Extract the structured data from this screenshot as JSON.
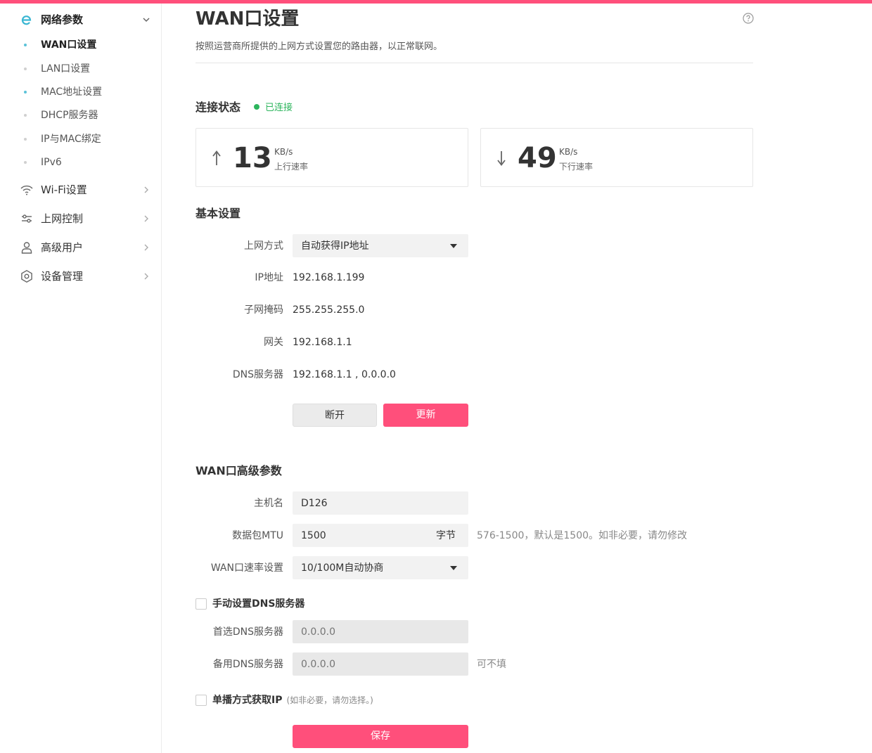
{
  "colors": {
    "accent": "#ff4f7b",
    "connected": "#2db55d",
    "active_dot": "#5bc2d8"
  },
  "sidebar": {
    "network": {
      "label": "网络参数",
      "icon": "brand-e-icon"
    },
    "sub_items": [
      {
        "label": "WAN口设置",
        "active": true
      },
      {
        "label": "LAN口设置",
        "active": false
      },
      {
        "label": "MAC地址设置",
        "active": true
      },
      {
        "label": "DHCP服务器",
        "active": false
      },
      {
        "label": "IP与MAC绑定",
        "active": false
      },
      {
        "label": "IPv6",
        "active": false
      }
    ],
    "groups": [
      {
        "label": "Wi-Fi设置",
        "icon": "wifi-icon"
      },
      {
        "label": "上网控制",
        "icon": "sliders-icon"
      },
      {
        "label": "高级用户",
        "icon": "user-icon"
      },
      {
        "label": "设备管理",
        "icon": "gear-icon"
      }
    ]
  },
  "page": {
    "title": "WAN口设置",
    "subtitle": "按照运营商所提供的上网方式设置您的路由器，以正常联网。"
  },
  "connection": {
    "title": "连接状态",
    "status": "已连接",
    "upload": {
      "value": "13",
      "unit": "KB/s",
      "label": "上行速率"
    },
    "download": {
      "value": "49",
      "unit": "KB/s",
      "label": "下行速率"
    }
  },
  "basic": {
    "title": "基本设置",
    "mode_label": "上网方式",
    "mode_value": "自动获得IP地址",
    "ip_label": "IP地址",
    "ip_value": "192.168.1.199",
    "mask_label": "子网掩码",
    "mask_value": "255.255.255.0",
    "gateway_label": "网关",
    "gateway_value": "192.168.1.1",
    "dns_label": "DNS服务器",
    "dns_value": "192.168.1.1 , 0.0.0.0",
    "disconnect_label": "断开",
    "renew_label": "更新"
  },
  "advanced": {
    "title": "WAN口高级参数",
    "hostname_label": "主机名",
    "hostname_value": "D126",
    "mtu_label": "数据包MTU",
    "mtu_value": "1500",
    "mtu_unit": "字节",
    "mtu_hint": "576-1500，默认是1500。如非必要，请勿修改",
    "speed_label": "WAN口速率设置",
    "speed_value": "10/100M自动协商",
    "manual_dns_label": "手动设置DNS服务器",
    "primary_dns_label": "首选DNS服务器",
    "primary_dns_placeholder": "0.0.0.0",
    "secondary_dns_label": "备用DNS服务器",
    "secondary_dns_placeholder": "0.0.0.0",
    "secondary_dns_hint": "可不填",
    "unicast_label": "单播方式获取IP",
    "unicast_note": "(如非必要，请勿选择。)",
    "save_label": "保存"
  }
}
